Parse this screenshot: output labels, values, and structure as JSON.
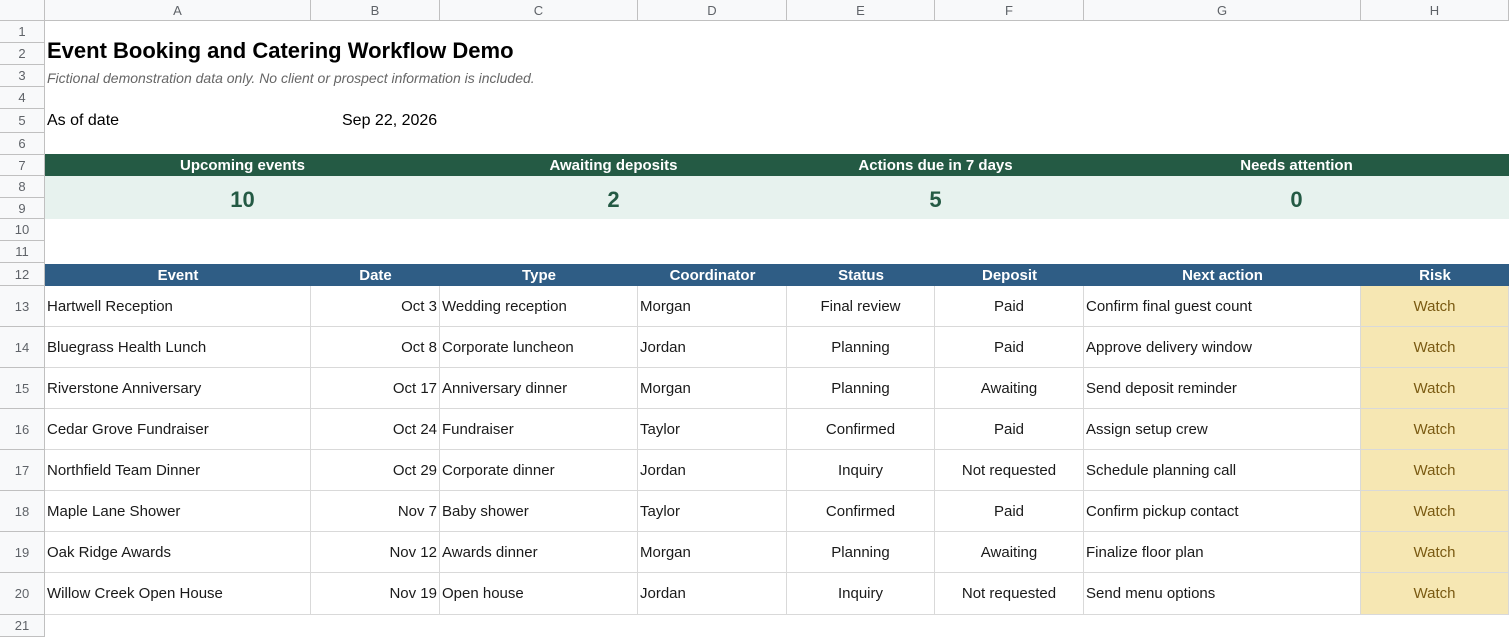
{
  "columns": [
    "A",
    "B",
    "C",
    "D",
    "E",
    "F",
    "G",
    "H"
  ],
  "row_numbers": [
    "1",
    "2",
    "3",
    "4",
    "5",
    "6",
    "7",
    "8",
    "9",
    "10",
    "11",
    "12",
    "13",
    "14",
    "15",
    "16",
    "17",
    "18",
    "19",
    "20",
    "21"
  ],
  "sheet": {
    "title": "Event Booking and Catering Workflow Demo",
    "subtitle": "Fictional demonstration data only. No client or prospect information is included.",
    "as_of_label": "As of date",
    "as_of_value": "Sep 22, 2026"
  },
  "kpis": [
    {
      "label": "Upcoming events",
      "value": "10"
    },
    {
      "label": "Awaiting deposits",
      "value": "2"
    },
    {
      "label": "Actions due in 7 days",
      "value": "5"
    },
    {
      "label": "Needs attention",
      "value": "0"
    }
  ],
  "table": {
    "headers": [
      "Event",
      "Date",
      "Type",
      "Coordinator",
      "Status",
      "Deposit",
      "Next action",
      "Risk"
    ],
    "rows": [
      [
        "Hartwell Reception",
        "Oct 3",
        "Wedding reception",
        "Morgan",
        "Final review",
        "Paid",
        "Confirm final guest count",
        "Watch"
      ],
      [
        "Bluegrass Health Lunch",
        "Oct 8",
        "Corporate luncheon",
        "Jordan",
        "Planning",
        "Paid",
        "Approve delivery window",
        "Watch"
      ],
      [
        "Riverstone Anniversary",
        "Oct 17",
        "Anniversary dinner",
        "Morgan",
        "Planning",
        "Awaiting",
        "Send deposit reminder",
        "Watch"
      ],
      [
        "Cedar Grove Fundraiser",
        "Oct 24",
        "Fundraiser",
        "Taylor",
        "Confirmed",
        "Paid",
        "Assign setup crew",
        "Watch"
      ],
      [
        "Northfield Team Dinner",
        "Oct 29",
        "Corporate dinner",
        "Jordan",
        "Inquiry",
        "Not requested",
        "Schedule planning call",
        "Watch"
      ],
      [
        "Maple Lane Shower",
        "Nov 7",
        "Baby shower",
        "Taylor",
        "Confirmed",
        "Paid",
        "Confirm pickup contact",
        "Watch"
      ],
      [
        "Oak Ridge Awards",
        "Nov 12",
        "Awards dinner",
        "Morgan",
        "Planning",
        "Awaiting",
        "Finalize floor plan",
        "Watch"
      ],
      [
        "Willow Creek Open House",
        "Nov 19",
        "Open house",
        "Jordan",
        "Inquiry",
        "Not requested",
        "Send menu options",
        "Watch"
      ]
    ]
  },
  "colors": {
    "kpi_header": "#245a44",
    "kpi_values_bg": "#e7f2ee",
    "table_header": "#2f5d85",
    "risk_fill": "#f6e7b3"
  }
}
